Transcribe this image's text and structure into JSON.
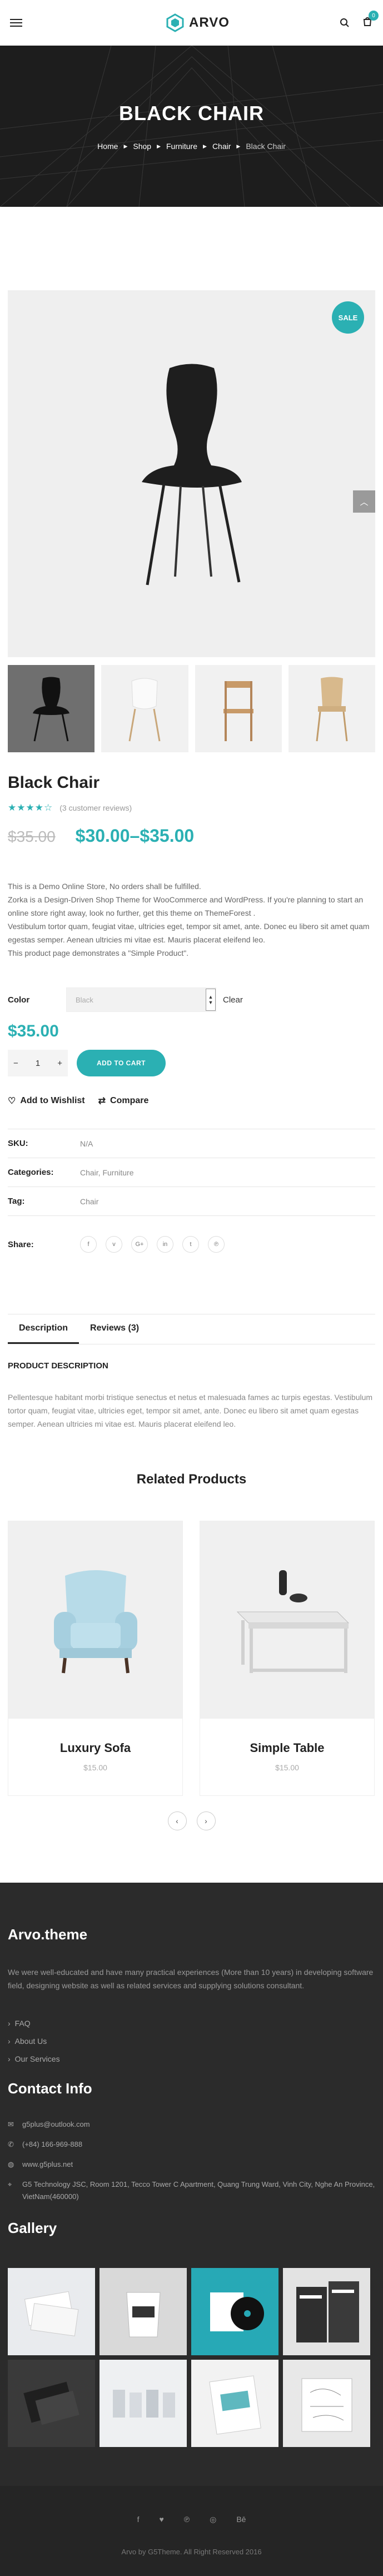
{
  "header": {
    "brand": "ARVO",
    "cart_count": "0",
    "icons": [
      "menu-icon",
      "search-icon",
      "cart-icon"
    ]
  },
  "hero": {
    "title": "BLACK CHAIR",
    "breadcrumb": [
      "Home",
      "Shop",
      "Furniture",
      "Chair",
      "Black Chair"
    ]
  },
  "product": {
    "sale_badge": "SALE",
    "title": "Black Chair",
    "stars": "★★★★☆",
    "reviews_text": "(3 customer reviews)",
    "old_price": "$35.00",
    "price_range": "$30.00–$35.00",
    "description": [
      "This is a Demo Online Store, No orders shall be fulfilled.",
      "Zorka is a Design-Driven Shop Theme for WooCommerce and WordPress. If you're planning to start an online store right away, look no further, get this theme on ThemeForest .",
      "Vestibulum tortor quam, feugiat vitae, ultricies eget, tempor sit amet, ante. Donec eu libero sit amet quam egestas semper. Aenean ultricies mi vitae est. Mauris placerat eleifend leo.",
      "This product page demonstrates a \"Simple Product\"."
    ],
    "color_label": "Color",
    "color_value": "Black",
    "clear_label": "Clear",
    "variation_price": "$35.00",
    "qty_minus": "−",
    "qty_value": "1",
    "qty_plus": "+",
    "add_to_cart": "ADD TO CART",
    "wishlist_label": "Add to Wishlist",
    "compare_label": "Compare",
    "meta": {
      "sku_label": "SKU:",
      "sku_value": "N/A",
      "categories_label": "Categories:",
      "categories_value": "Chair, Furniture",
      "tag_label": "Tag:",
      "tag_value": "Chair"
    },
    "share_label": "Share:",
    "share_icons": [
      "f",
      "v",
      "G+",
      "in",
      "t",
      "℗"
    ]
  },
  "tabs": {
    "items": [
      "Description",
      "Reviews (3)"
    ],
    "heading": "PRODUCT DESCRIPTION",
    "text": "Pellentesque habitant morbi tristique senectus et netus et malesuada fames ac turpis egestas. Vestibulum tortor quam, feugiat vitae, ultricies eget, tempor sit amet, ante. Donec eu libero sit amet quam egestas semper. Aenean ultricies mi vitae est. Mauris placerat eleifend leo."
  },
  "related": {
    "title": "Related Products",
    "items": [
      {
        "name": "Luxury Sofa",
        "price": "$15.00"
      },
      {
        "name": "Simple Table",
        "price": "$15.00"
      }
    ],
    "prev": "‹",
    "next": "›"
  },
  "footer": {
    "brand": "Arvo.theme",
    "about": "We were well-educated and have many practical experiences (More than 10 years) in developing software field, designing website as well as related services and supplying solutions consultant.",
    "links": [
      "FAQ",
      "About Us",
      "Our Services"
    ],
    "contact_heading": "Contact Info",
    "contact": [
      {
        "icon": "mail-icon",
        "text": "g5plus@outlook.com"
      },
      {
        "icon": "phone-icon",
        "text": "(+84) 166-969-888"
      },
      {
        "icon": "globe-icon",
        "text": "www.g5plus.net"
      },
      {
        "icon": "location-icon",
        "text": "G5 Technology JSC, Room 1201, Tecco Tower C Apartment, Quang Trung Ward, Vinh City, Nghe An Province, VietNam(460000)"
      }
    ],
    "gallery_heading": "Gallery",
    "social": [
      "f",
      "♥",
      "℗",
      "◎",
      "Bē"
    ],
    "copyright": "Arvo by G5Theme. All Right Reserved 2016"
  }
}
